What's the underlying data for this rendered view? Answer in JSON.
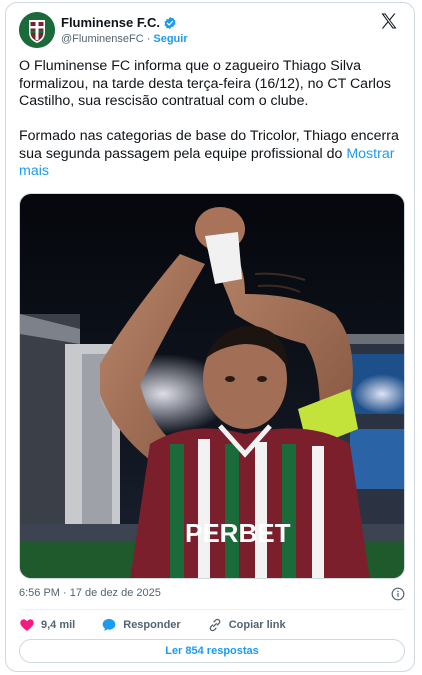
{
  "account": {
    "display_name": "Fluminense F.C.",
    "handle": "@FluminenseFC",
    "separator": "·",
    "follow_label": "Seguir"
  },
  "tweet": {
    "paragraph1": "O Fluminense FC informa que o zagueiro Thiago Silva formalizou, na tarde desta terça-feira (16/12), no CT Carlos Castilho, sua rescisão contratual com o clube.",
    "paragraph2": "Formado nas categorias de base do Tricolor, Thiago encerra sua segunda passagem pela equipe profissional do",
    "show_more": "Mostrar mais"
  },
  "photo_text": {
    "jersey_sponsor": "PERBET"
  },
  "meta": {
    "timestamp": "6:56 PM · 17 de dez de 2025"
  },
  "actions": {
    "likes": "9,4 mil",
    "reply_label": "Responder",
    "copy_link_label": "Copiar link"
  },
  "replies_button": "Ler 854 respostas",
  "colors": {
    "accent": "#1d9bf0",
    "like": "#f91880",
    "club_green": "#1b6b3a",
    "club_maroon": "#7a1f2b"
  },
  "icons": [
    "verified-badge-icon",
    "x-logo-icon",
    "info-icon",
    "heart-icon",
    "reply-icon",
    "link-icon"
  ]
}
